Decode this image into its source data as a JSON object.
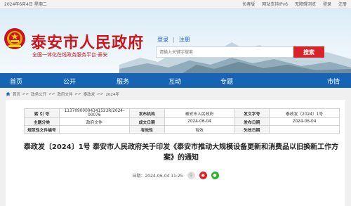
{
  "topbar": {
    "date": "2024年6月4日 星期二",
    "links": [
      "长者版",
      "网站支持IPv6",
      "无障碍浏览",
      "登录",
      "注册"
    ]
  },
  "header": {
    "site_title": "泰安市人民政府",
    "subtitle": "全国一体化在线政务服务平台·泰安",
    "login": "登录",
    "register": "注册",
    "search_placeholder": "请输入关键字搜索",
    "search_button": "搜索"
  },
  "nav": [
    "首页",
    "公开",
    "服务",
    "互动",
    "专题",
    "市情"
  ],
  "breadcrumb": [
    "首页",
    "政务公开",
    "政府文件",
    "泰政发",
    "2024年"
  ],
  "info_table": {
    "rows": [
      [
        {
          "k": "索 引 号",
          "v": "11370900004341523R/2024-00076"
        },
        {
          "k": "发布机构",
          "v": "泰安市人民政府"
        },
        {
          "k": "发文字号",
          "v": "泰政发〔2024〕1号"
        }
      ],
      [
        {
          "k": "主题分类",
          "v": "政府文件"
        },
        {
          "k": "成文日期",
          "v": "2024-06-04"
        },
        {
          "k": "发布日期",
          "v": "2024-06-04"
        }
      ],
      [
        {
          "k": "规范性文件编号",
          "v": ""
        },
        {
          "k": "有效性",
          "v": "有效"
        },
        {
          "k": "失效日期",
          "v": ""
        }
      ]
    ]
  },
  "document": {
    "title": "泰政发〔2024〕1号 泰安市人民政府关于印发《泰安市推动大规模设备更新和消费品以旧换新工作方案》的通知",
    "date": "日期：2024-06-04 11:25"
  },
  "colors": {
    "brand_red": "#c8161d",
    "nav_blue": "#1763b4",
    "search_red": "#d9232a"
  }
}
